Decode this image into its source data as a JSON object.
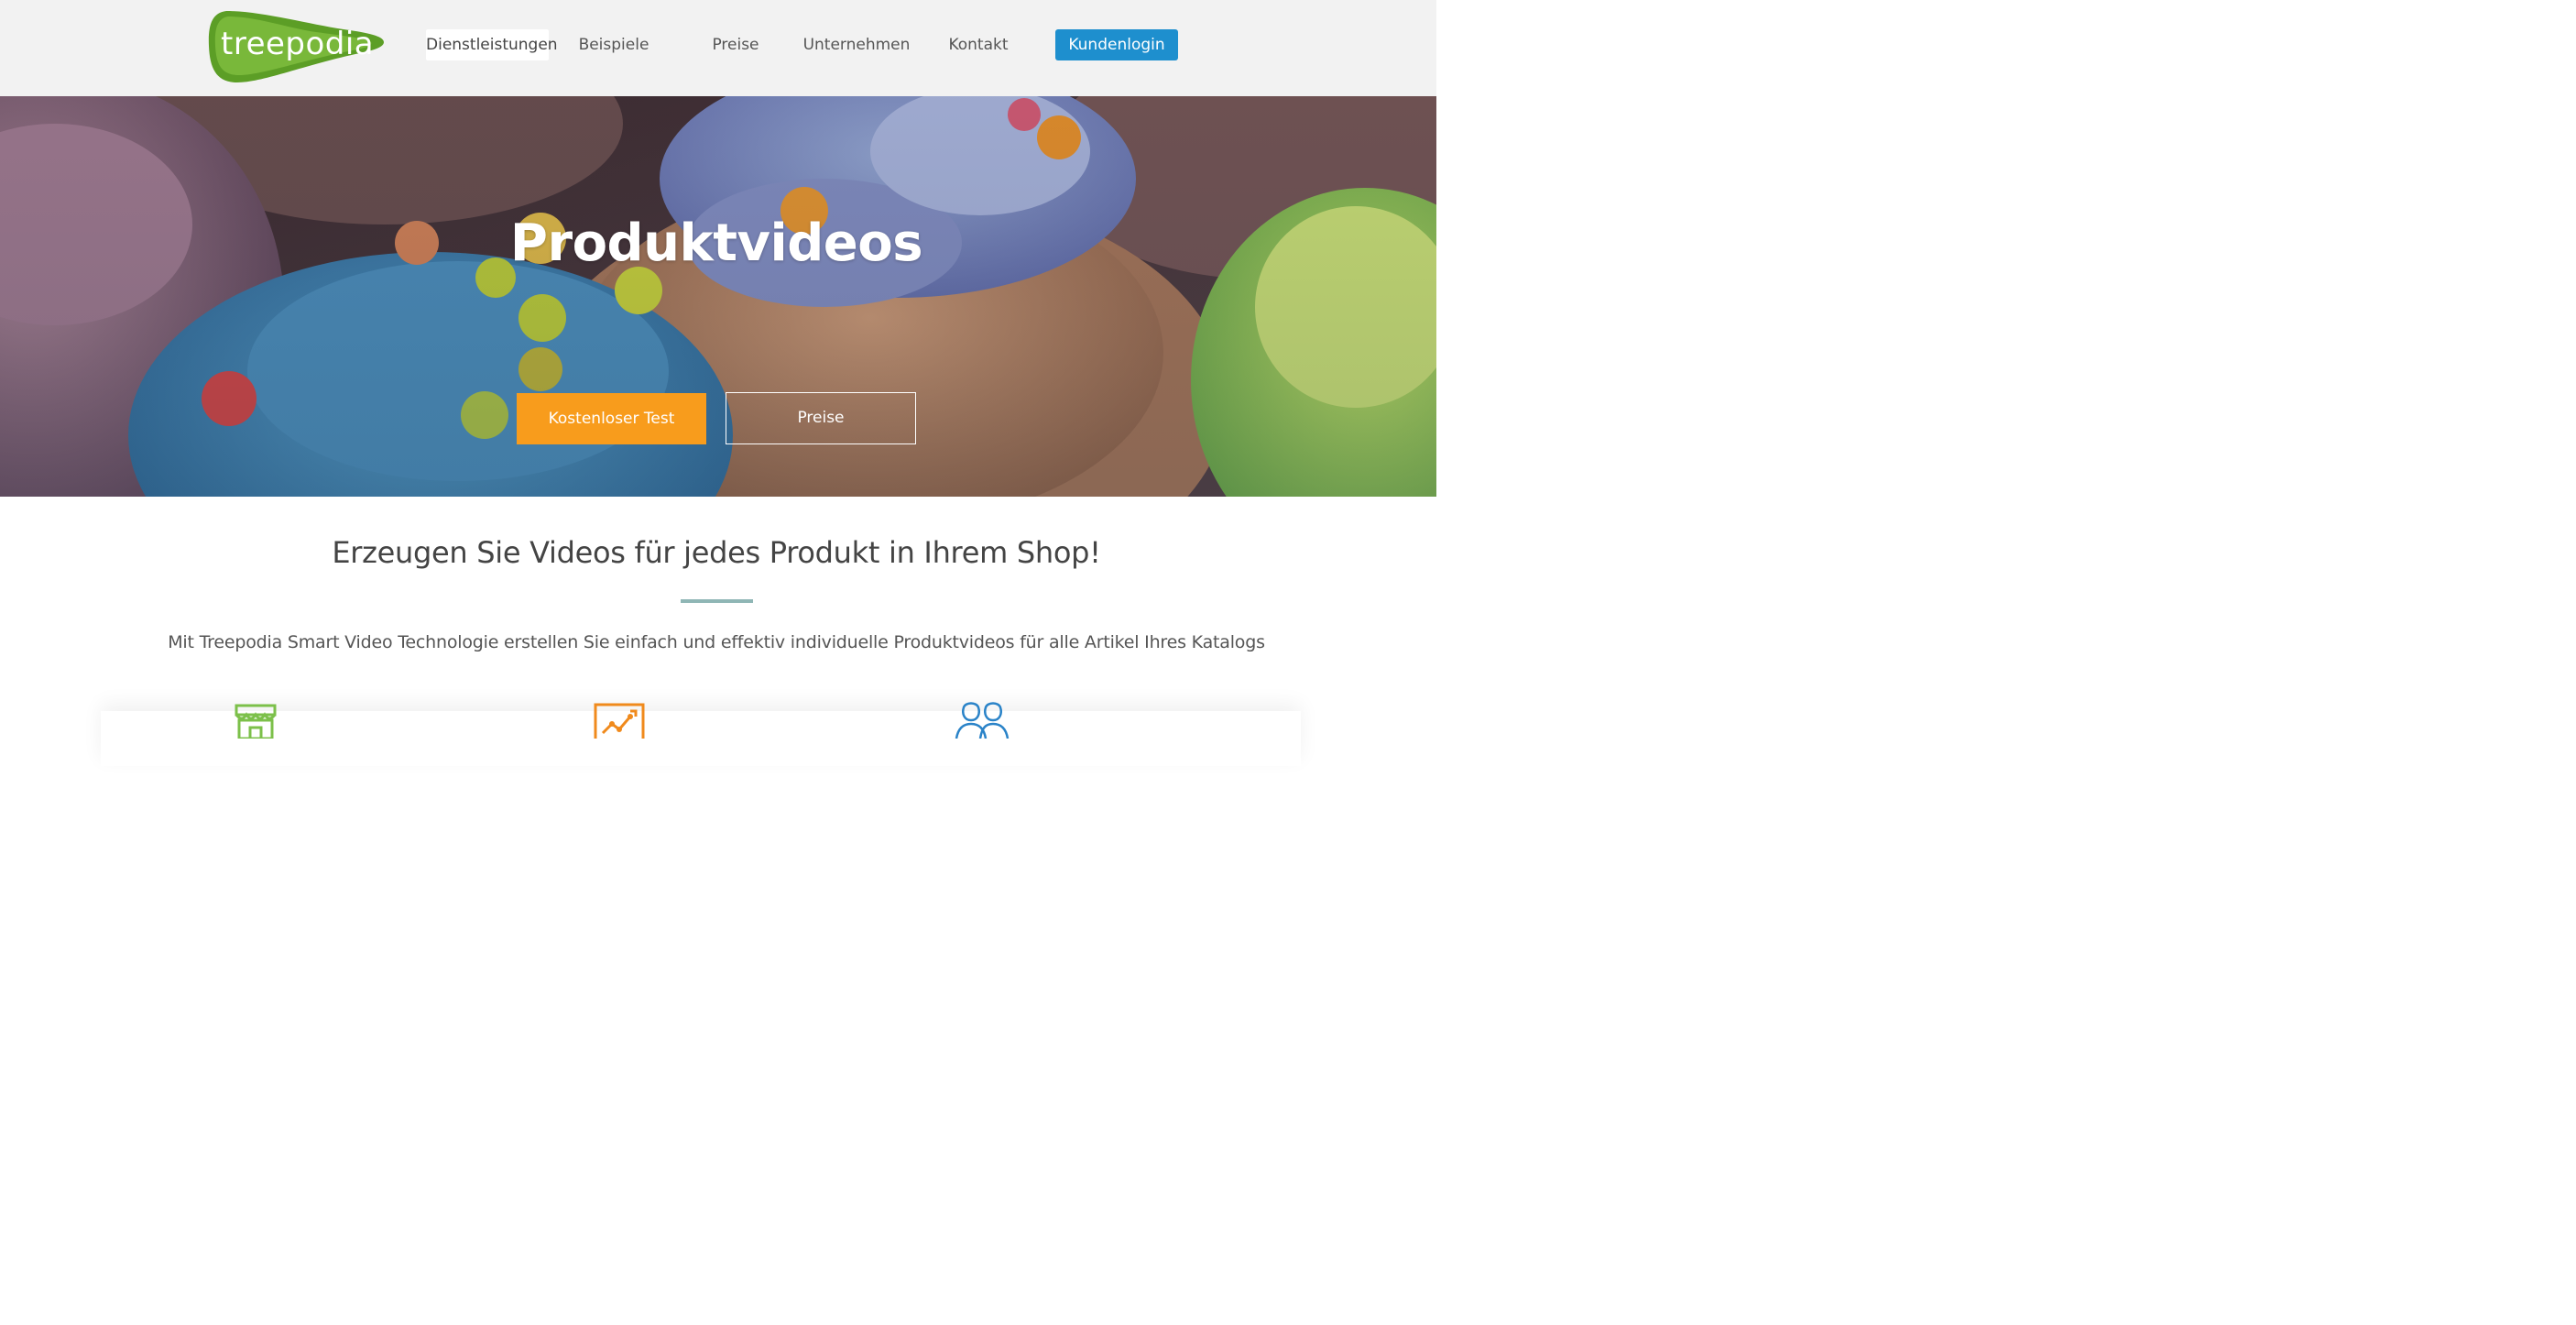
{
  "header": {
    "logo_text": "treepodia",
    "nav": [
      {
        "label": "Dienstleistungen",
        "active": true
      },
      {
        "label": "Beispiele",
        "active": false
      },
      {
        "label": "Preise",
        "active": false
      },
      {
        "label": "Unternehmen",
        "active": false
      },
      {
        "label": "Kontakt",
        "active": false
      }
    ],
    "login_label": "Kundenlogin"
  },
  "hero": {
    "title": "Produktvideos",
    "primary_button": "Kostenloser Test",
    "secondary_button": "Preise"
  },
  "content": {
    "headline": "Erzeugen Sie Videos für jedes Produkt in Ihrem Shop!",
    "subline": "Mit Treepodia Smart Video Technologie erstellen Sie einfach und effektiv individuelle Produktvideos für alle Artikel Ihres Katalogs",
    "feature_icons": [
      "storefront-icon",
      "analytics-chart-icon",
      "users-icon"
    ]
  },
  "colors": {
    "brand_green": "#6aaa2a",
    "login_blue": "#1e8fce",
    "cta_orange": "#f89c1c",
    "divider_teal": "#8fb6b5"
  }
}
